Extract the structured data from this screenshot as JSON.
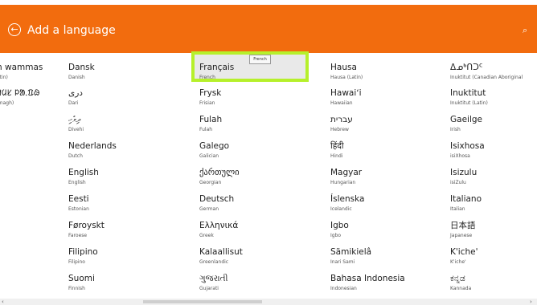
{
  "header": {
    "back_icon": "back-arrow-circle-icon",
    "title": "Add a language",
    "search_icon": "search-icon",
    "color": "#f26c0e"
  },
  "tooltip": "French",
  "columns": [
    [
      {
        "native": "n wammas",
        "english": "atin)"
      },
      {
        "native": "ᱤᱢᱥ ᱞᱟᱹᱯᱷ",
        "english": "finagh)"
      }
    ],
    [
      {
        "native": "Dansk",
        "english": "Danish"
      },
      {
        "native": "دری",
        "english": "Dari"
      },
      {
        "native": "ދިވެހި",
        "english": "Divehi"
      },
      {
        "native": "Nederlands",
        "english": "Dutch"
      },
      {
        "native": "English",
        "english": "English"
      },
      {
        "native": "Eesti",
        "english": "Estonian"
      },
      {
        "native": "Føroyskt",
        "english": "Faroese"
      },
      {
        "native": "Filipino",
        "english": "Filipino"
      },
      {
        "native": "Suomi",
        "english": "Finnish"
      }
    ],
    [
      {
        "native": "Français",
        "english": "French"
      },
      {
        "native": "Frysk",
        "english": "Frisian"
      },
      {
        "native": "Fulah",
        "english": "Fulah"
      },
      {
        "native": "Galego",
        "english": "Galician"
      },
      {
        "native": "ქართული",
        "english": "Georgian"
      },
      {
        "native": "Deutsch",
        "english": "German"
      },
      {
        "native": "Ελληνικά",
        "english": "Greek"
      },
      {
        "native": "Kalaallisut",
        "english": "Greenlandic"
      },
      {
        "native": "ગુજરાતી",
        "english": "Gujarati"
      }
    ],
    [
      {
        "native": "Hausa",
        "english": "Hausa (Latin)"
      },
      {
        "native": "Hawaiʻi",
        "english": "Hawaiian"
      },
      {
        "native": "עברית",
        "english": "Hebrew"
      },
      {
        "native": "हिंदी",
        "english": "Hindi"
      },
      {
        "native": "Magyar",
        "english": "Hungarian"
      },
      {
        "native": "Íslenska",
        "english": "Icelandic"
      },
      {
        "native": "Igbo",
        "english": "Igbo"
      },
      {
        "native": "Sämikielâ",
        "english": "Inari Sami"
      },
      {
        "native": "Bahasa Indonesia",
        "english": "Indonesian"
      }
    ],
    [
      {
        "native": "ᐃᓄᒃᑎᑐᑦ",
        "english": "Inuktitut (Canadian Aboriginal"
      },
      {
        "native": "Inuktitut",
        "english": "Inuktitut (Latin)"
      },
      {
        "native": "Gaeilge",
        "english": "Irish"
      },
      {
        "native": "Isixhosa",
        "english": "isiXhosa"
      },
      {
        "native": "Isizulu",
        "english": "isiZulu"
      },
      {
        "native": "Italiano",
        "english": "Italian"
      },
      {
        "native": "日本語",
        "english": "Japanese"
      },
      {
        "native": "K'iche'",
        "english": "K'iche'"
      },
      {
        "native": "ಕನ್ನಡ",
        "english": "Kannada"
      }
    ]
  ],
  "scrollbar": {
    "left_arrow": "‹",
    "right_arrow": "›"
  }
}
